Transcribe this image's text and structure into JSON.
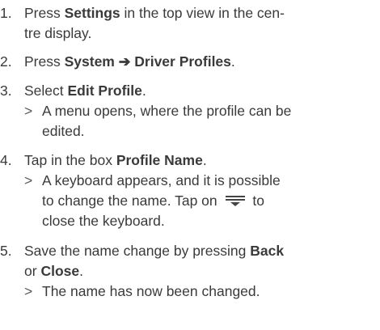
{
  "steps": [
    {
      "number": "1.",
      "pre": "Press ",
      "bold": "Settings",
      "post_line1": " in the top view in the cen-",
      "line2": "tre display."
    },
    {
      "number": "2.",
      "pre": "Press ",
      "bold": "System ➔ Driver Profiles",
      "post": "."
    },
    {
      "number": "3.",
      "pre": "Select ",
      "bold": "Edit Profile",
      "post": ".",
      "result_marker": ">",
      "result_line1": "A menu opens, where the profile can be",
      "result_line2": "edited."
    },
    {
      "number": "4.",
      "pre": "Tap in the box ",
      "bold": "Profile Name",
      "post": ".",
      "result_marker": ">",
      "result_line1": "A keyboard appears, and it is possible",
      "result_line2_pre": "to change the name. Tap on",
      "result_line2_icon": "keyboard-hide-icon",
      "result_line2_post": "to",
      "result_line3": "close the keyboard."
    },
    {
      "number": "5.",
      "pre": "Save the name change by pressing ",
      "bold1": "Back",
      "line2_pre": "or ",
      "bold2": "Close",
      "post": ".",
      "result_marker": ">",
      "result_line1": "The name has now been changed."
    }
  ]
}
